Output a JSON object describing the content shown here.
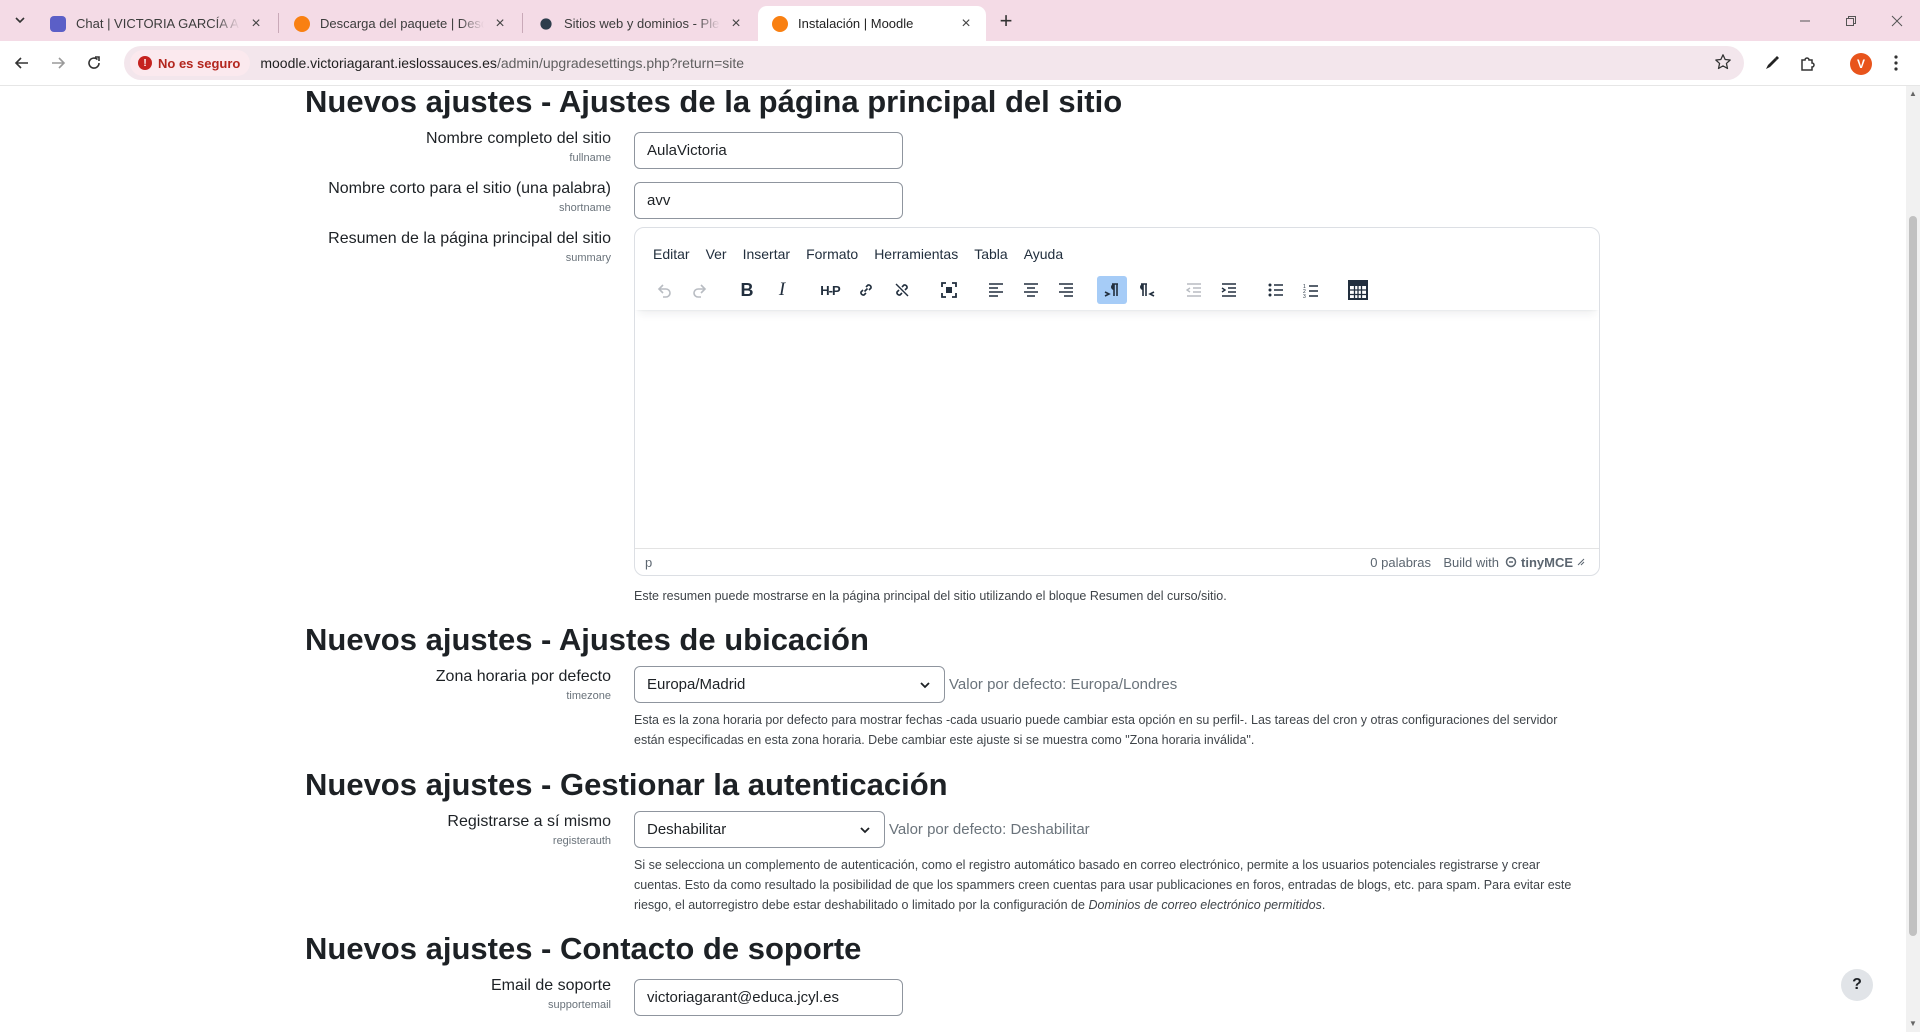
{
  "browser": {
    "tabs": [
      {
        "title": "Chat | VICTORIA GARCÍA ANTÓ",
        "favicon_color": "#5b5fc7"
      },
      {
        "title": "Descarga del paquete | Descarg",
        "favicon_color": "#f98012"
      },
      {
        "title": "Sitios web y dominios - Plesk -",
        "favicon_color": "#2d3d4c"
      },
      {
        "title": "Instalación | Moodle",
        "favicon_color": "#f98012"
      }
    ],
    "security_label": "No es seguro",
    "url_host": "moodle.victoriagarant.ieslossauces.es",
    "url_path": "/admin/upgradesettings.php?return=site",
    "profile_initial": "V"
  },
  "sections": {
    "front_page": {
      "heading": "Nuevos ajustes - Ajustes de la página principal del sitio",
      "fullname_label": "Nombre completo del sitio",
      "fullname_key": "fullname",
      "fullname_value": "AulaVictoria",
      "shortname_label": "Nombre corto para el sitio (una palabra)",
      "shortname_key": "shortname",
      "shortname_value": "avv",
      "summary_label": "Resumen de la página principal del sitio",
      "summary_key": "summary",
      "summary_help": "Este resumen puede mostrarse en la página principal del sitio utilizando el bloque Resumen del curso/sitio."
    },
    "location": {
      "heading": "Nuevos ajustes - Ajustes de ubicación",
      "timezone_label": "Zona horaria por defecto",
      "timezone_key": "timezone",
      "timezone_value": "Europa/Madrid",
      "timezone_default": "Valor por defecto: Europa/Londres",
      "timezone_help_1": "Esta es la zona horaria por defecto para mostrar fechas -cada usuario puede cambiar esta opción en su perfil-. Las tareas del cron y otras configuraciones del servidor",
      "timezone_help_2": "están especificadas en esta zona horaria. Debe cambiar este ajuste si se muestra como \"Zona horaria inválida\"."
    },
    "auth": {
      "heading": "Nuevos ajustes - Gestionar la autenticación",
      "register_label": "Registrarse a sí mismo",
      "register_key": "registerauth",
      "register_value": "Deshabilitar",
      "register_default": "Valor por defecto: Deshabilitar",
      "register_help_1": "Si se selecciona un complemento de autenticación, como el registro automático basado en correo electrónico, permite a los usuarios potenciales registrarse y crear",
      "register_help_2": "cuentas. Esto da como resultado la posibilidad de que los spammers creen cuentas para usar publicaciones en foros, entradas de blogs, etc. para spam. Para evitar este",
      "register_help_3a": "riesgo, el autorregistro debe estar deshabilitado o limitado por la configuración de ",
      "register_help_3b": "Dominios de correo electrónico permitidos",
      "register_help_3c": "."
    },
    "support": {
      "heading": "Nuevos ajustes - Contacto de soporte",
      "email_label": "Email de soporte",
      "email_key": "supportemail",
      "email_value": "victoriagarant@educa.jcyl.es"
    }
  },
  "editor": {
    "menus": [
      "Editar",
      "Ver",
      "Insertar",
      "Formato",
      "Herramientas",
      "Tabla",
      "Ayuda"
    ],
    "status_path": "p",
    "word_count": "0 palabras",
    "build_with": "Build with",
    "brand": "tinyMCE",
    "h5p_label": "H-P"
  },
  "help_button": "?"
}
